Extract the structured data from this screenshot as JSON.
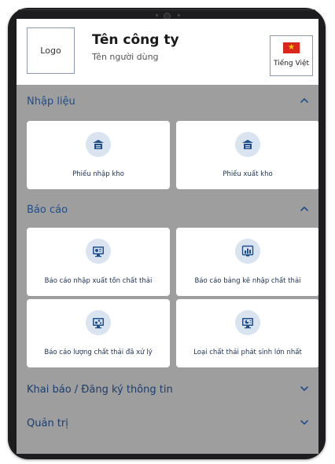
{
  "header": {
    "logo": "Logo",
    "company_name": "Tên công ty",
    "user_name": "Tên người dùng",
    "language_label": "Tiếng Việt"
  },
  "sections": [
    {
      "title": "Nhập liệu",
      "expanded": true,
      "items": [
        {
          "label": "Phiếu nhập kho",
          "icon": "warehouse-import-icon"
        },
        {
          "label": "Phiếu xuất kho",
          "icon": "warehouse-export-icon"
        }
      ]
    },
    {
      "title": "Báo cáo",
      "expanded": true,
      "items": [
        {
          "label": "Báo cáo nhập xuất tồn chất thải",
          "icon": "monitor-chart-icon"
        },
        {
          "label": "Báo cáo bảng kê nhập chất thải",
          "icon": "bar-chart-icon"
        },
        {
          "label": "Báo cáo lượng chất thải đã xử lý",
          "icon": "monitor-process-icon"
        },
        {
          "label": "Loại chất thải phát sinh lớn nhất",
          "icon": "monitor-pie-icon"
        }
      ]
    },
    {
      "title": "Khai báo / Đăng ký thông tin",
      "expanded": false
    },
    {
      "title": "Quản trị",
      "expanded": false
    }
  ],
  "colors": {
    "primary": "#1f4e8c",
    "overlay": "#9e9e9e",
    "icon_bg": "#d9e4f0",
    "flag_red": "#da251d",
    "flag_star": "#ffcd00"
  }
}
